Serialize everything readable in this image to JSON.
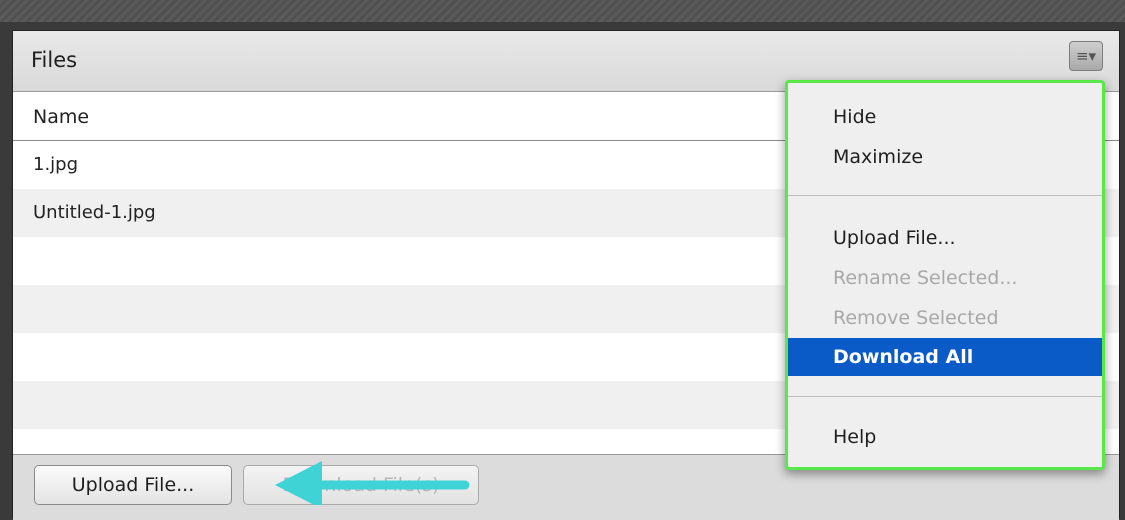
{
  "panel": {
    "title": "Files",
    "menu_icon": "hamburger-dropdown-icon"
  },
  "table": {
    "column_name": "Name",
    "rows": [
      "1.jpg",
      "Untitled-1.jpg",
      "",
      "",
      "",
      "",
      ""
    ]
  },
  "footer": {
    "upload_label": "Upload File...",
    "download_label": "Download File(s)"
  },
  "menu": {
    "items": [
      {
        "label": "Hide",
        "state": "enabled"
      },
      {
        "label": "Maximize",
        "state": "enabled"
      },
      {
        "label": "Upload File...",
        "state": "enabled"
      },
      {
        "label": "Rename Selected...",
        "state": "disabled"
      },
      {
        "label": "Remove Selected",
        "state": "disabled"
      },
      {
        "label": "Download All",
        "state": "highlighted"
      },
      {
        "label": "Help",
        "state": "enabled"
      }
    ]
  },
  "colors": {
    "highlight": "#0a5bc7",
    "menu_outline": "#59e84a",
    "annotation_arrow": "#3fd3d6"
  }
}
